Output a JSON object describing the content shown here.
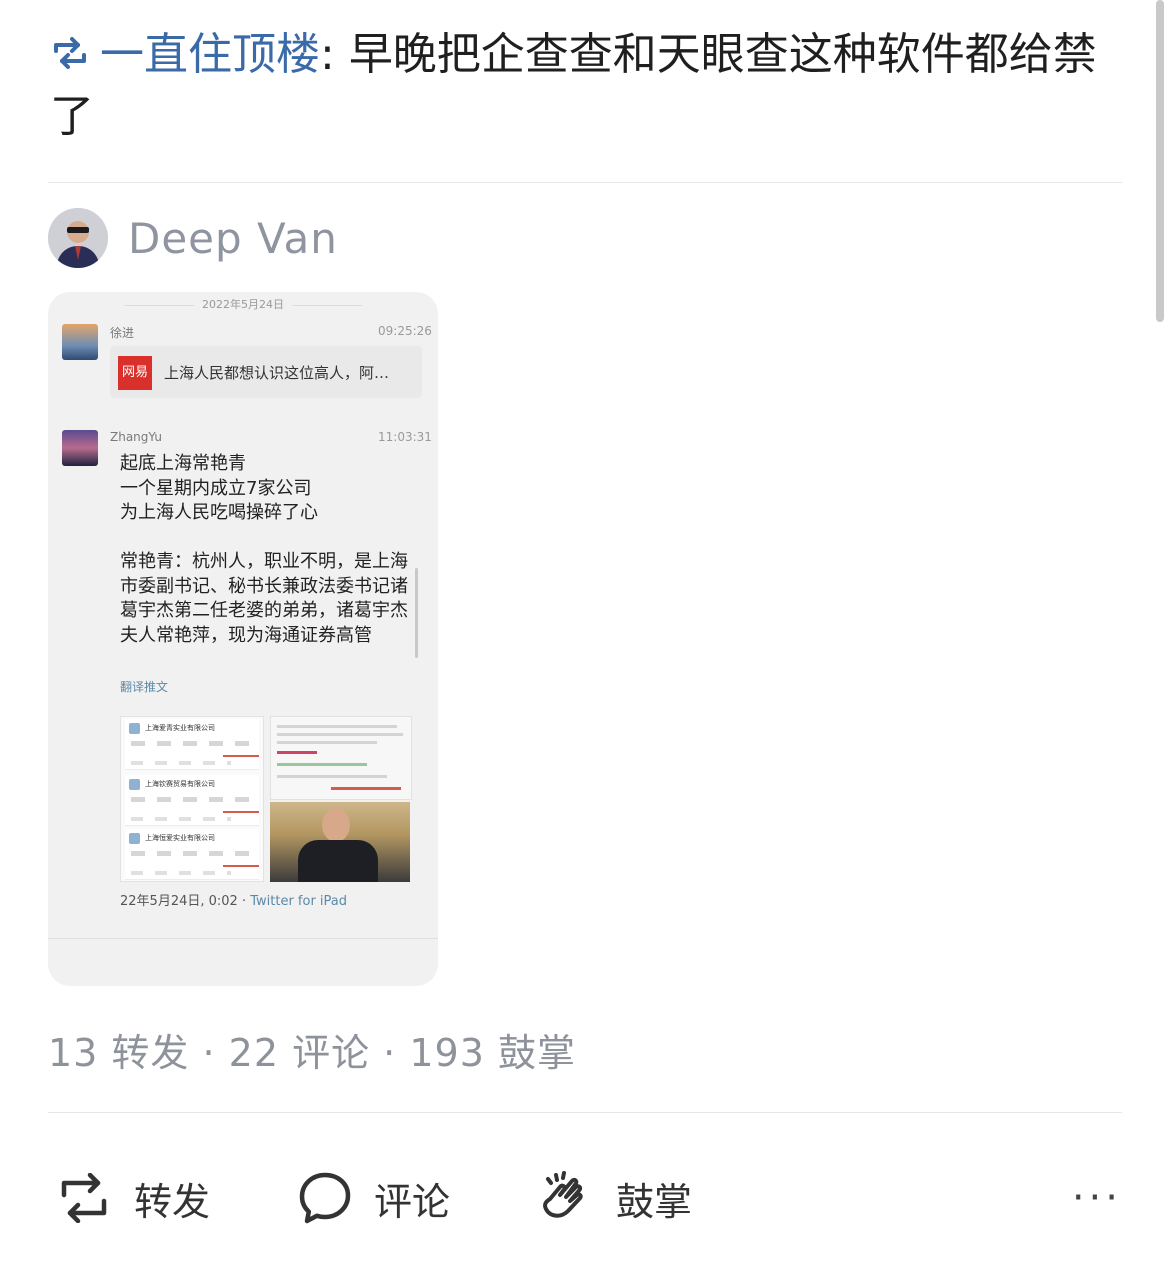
{
  "repost": {
    "username": "一直住顶楼",
    "separator": ": ",
    "text": "早晚把企查查和天眼查这种软件都给禁了"
  },
  "author": {
    "name": "Deep Van"
  },
  "embedded_screenshot": {
    "date": "2022年5月24日",
    "messages": [
      {
        "name": "徐进",
        "time": "09:25:26",
        "link_source": "网易",
        "link_text": "上海人民都想认识这位高人，阿…"
      },
      {
        "name": "ZhangYu",
        "time": "11:03:31"
      }
    ],
    "tweet_text": "起底上海常艳青\n一个星期内成立7家公司\n为上海人民吃喝操碎了心\n\n常艳青：杭州人，职业不明，是上海市委副书记、秘书长兼政法委书记诸葛宇杰第二任老婆的弟弟，诸葛宇杰夫人常艳萍，现为海通证券高管",
    "translate": "翻译推文",
    "companies": [
      "上海爱青实业有限公司",
      "上海钦赛贸易有限公司",
      "上海恒爱实业有限公司"
    ],
    "tweet_time": "22年5月24日, 0:02 · ",
    "tweet_source": "Twitter for iPad"
  },
  "stats": {
    "text": "13 转发 · 22 评论 · 193 鼓掌"
  },
  "actions": {
    "repost_label": "转发",
    "comment_label": "评论",
    "clap_label": "鼓掌",
    "more": "···"
  },
  "colors": {
    "username": "#3a6aa8",
    "muted": "#8e939b",
    "background": "#ffffff"
  }
}
